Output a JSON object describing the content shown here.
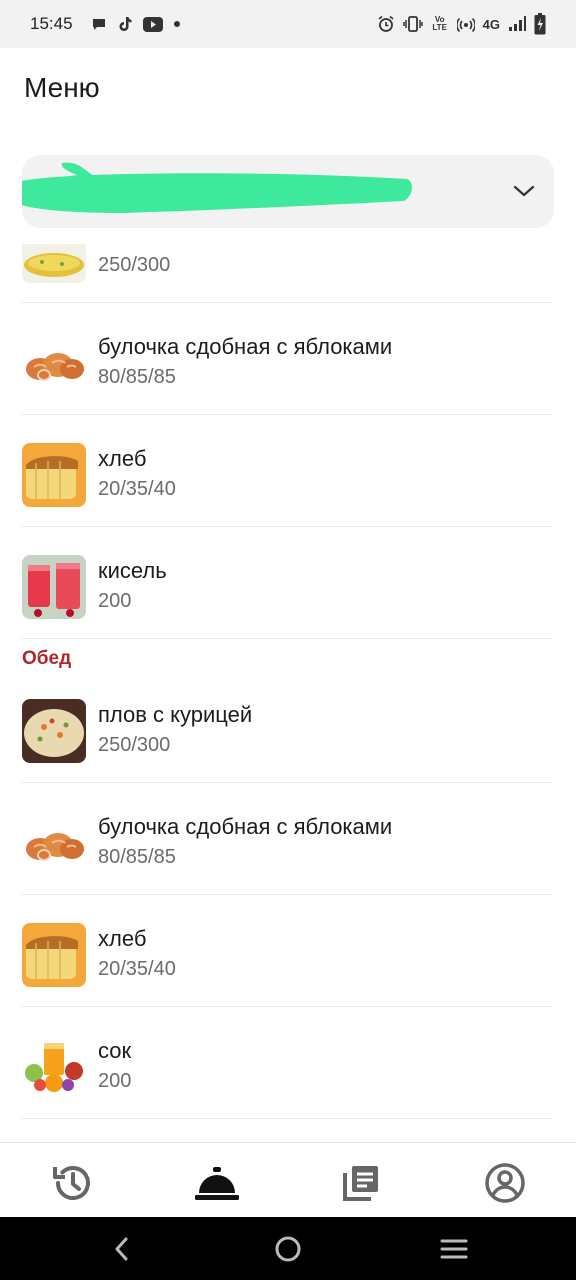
{
  "status_bar": {
    "time": "15:45",
    "network": "4G",
    "volte": "Vo LTE"
  },
  "header": {
    "title": "Меню"
  },
  "selector": {
    "value": ""
  },
  "menu": {
    "top_partial": {
      "portion": "250/300",
      "image": "omelette-thumbnail"
    },
    "breakfast_items": [
      {
        "name": "булочка сдобная с яблоками",
        "portion": "80/85/85",
        "image": "bun-thumbnail"
      },
      {
        "name": "хлеб",
        "portion": "20/35/40",
        "image": "bread-thumbnail"
      },
      {
        "name": "кисель",
        "portion": "200",
        "image": "kissel-thumbnail"
      }
    ],
    "lunch_title": "Обед",
    "lunch_items": [
      {
        "name": "плов с курицей",
        "portion": "250/300",
        "image": "pilaf-thumbnail"
      },
      {
        "name": "булочка сдобная с яблоками",
        "portion": "80/85/85",
        "image": "bun-thumbnail"
      },
      {
        "name": "хлеб",
        "portion": "20/35/40",
        "image": "bread-thumbnail"
      },
      {
        "name": "сок",
        "portion": "200",
        "image": "juice-thumbnail"
      }
    ]
  },
  "bottom_nav": {
    "items": [
      {
        "icon": "history-icon",
        "active": false
      },
      {
        "icon": "service-bell-icon",
        "active": true
      },
      {
        "icon": "library-icon",
        "active": false
      },
      {
        "icon": "account-icon",
        "active": false
      }
    ]
  },
  "colors": {
    "section_title": "#b3262b",
    "redaction": "#3ee89c",
    "selector_bg": "#f2f2f2"
  }
}
